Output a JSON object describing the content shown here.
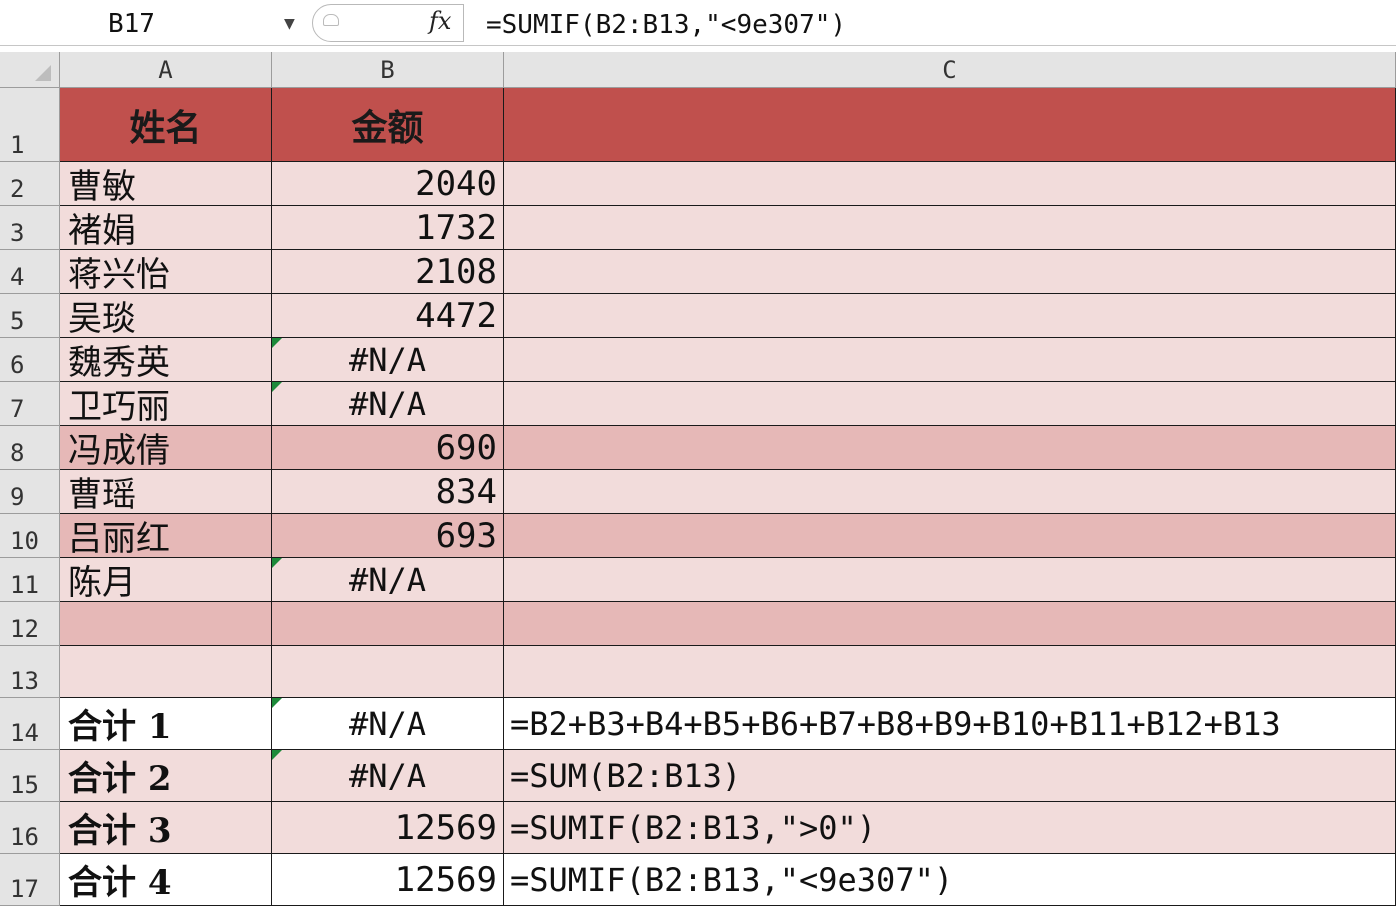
{
  "formula_bar": {
    "name_box": "B17",
    "dropdown_icon": "chevron-down-icon",
    "fx_label": "fx",
    "formula": "=SUMIF(B2:B13,\"<9e307\")"
  },
  "columns": [
    "A",
    "B",
    "C"
  ],
  "rows": [
    {
      "num": "1",
      "a": "姓名",
      "b": "金额",
      "c": "",
      "style": "header",
      "b_error": false
    },
    {
      "num": "2",
      "a": "曹敏",
      "b": "2040",
      "c": "",
      "style": "light",
      "b_error": false
    },
    {
      "num": "3",
      "a": "褚娟",
      "b": "1732",
      "c": "",
      "style": "light",
      "b_error": false
    },
    {
      "num": "4",
      "a": "蒋兴怡",
      "b": "2108",
      "c": "",
      "style": "light",
      "b_error": false
    },
    {
      "num": "5",
      "a": "吴琰",
      "b": "4472",
      "c": "",
      "style": "light",
      "b_error": false
    },
    {
      "num": "6",
      "a": "魏秀英",
      "b": "#N/A",
      "c": "",
      "style": "light",
      "b_error": true
    },
    {
      "num": "7",
      "a": "卫巧丽",
      "b": "#N/A",
      "c": "",
      "style": "light",
      "b_error": true
    },
    {
      "num": "8",
      "a": "冯成倩",
      "b": "690",
      "c": "",
      "style": "mid",
      "b_error": false
    },
    {
      "num": "9",
      "a": "曹瑶",
      "b": "834",
      "c": "",
      "style": "light",
      "b_error": false
    },
    {
      "num": "10",
      "a": "吕丽红",
      "b": "693",
      "c": "",
      "style": "mid",
      "b_error": false
    },
    {
      "num": "11",
      "a": "陈月",
      "b": "#N/A",
      "c": "",
      "style": "light",
      "b_error": true
    },
    {
      "num": "12",
      "a": "",
      "b": "",
      "c": "",
      "style": "mid",
      "b_error": false
    },
    {
      "num": "13",
      "a": "",
      "b": "",
      "c": "",
      "style": "light",
      "b_error": false
    },
    {
      "num": "14",
      "a": "合计  1",
      "b": "#N/A",
      "c": "=B2+B3+B4+B5+B6+B7+B8+B9+B10+B11+B12+B13",
      "style": "white",
      "b_error": true
    },
    {
      "num": "15",
      "a": "合计  2",
      "b": "#N/A",
      "c": "=SUM(B2:B13)",
      "style": "light",
      "b_error": true
    },
    {
      "num": "16",
      "a": "合计  3",
      "b": "12569",
      "c": "=SUMIF(B2:B13,\">0\")",
      "style": "light",
      "b_error": false
    },
    {
      "num": "17",
      "a": "合计  4",
      "b": "12569",
      "c": "=SUMIF(B2:B13,\"<9e307\")",
      "style": "white",
      "b_error": false
    }
  ],
  "colors": {
    "header_fill": "#c0504d",
    "light_fill": "#f2dcdb",
    "mid_fill": "#e6b8b7",
    "white_fill": "#ffffff",
    "error_flag": "#1d8a3a"
  }
}
